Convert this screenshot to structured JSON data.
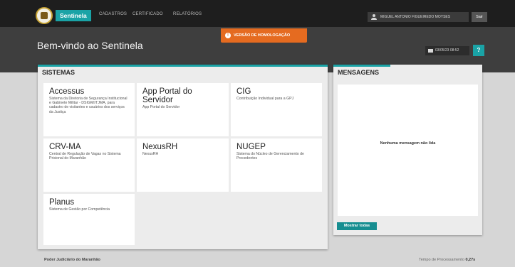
{
  "topbar": {
    "brand": "Sentinela",
    "nav": [
      "CADASTROS",
      "CERTIFICADO",
      "RELATÓRIOS"
    ],
    "user": "MIGUEL ANTONIO FIGUEIREDO MOYSES",
    "exit_label": "Sair"
  },
  "banner": {
    "homolog": "VERSÃO DE HOMOLOGAÇÃO"
  },
  "header": {
    "welcome": "Bem-vindo ao Sentinela",
    "datetime": "03/05/23 08:52",
    "help_label": "?"
  },
  "sistemas": {
    "title": "SISTEMAS",
    "cards": [
      {
        "title": "Accessus",
        "desc": "Sistema da Diretoria de Segurança Institucional e Gabinete Militar - DSIGMI/TJMA, para cadastro de visitantes e usuários dos serviços da Justiça"
      },
      {
        "title": "App Portal do Servidor",
        "desc": "App Portal do Servidor"
      },
      {
        "title": "CIG",
        "desc": "Contribuição Individual para a GPJ"
      },
      {
        "title": "CRV-MA",
        "desc": "Central de Regulação de Vagas no Sistema Prisional do Maranhão"
      },
      {
        "title": "NexusRH",
        "desc": "NexusRH"
      },
      {
        "title": "NUGEP",
        "desc": "Sistema do Núcleo de Gerenciamento de Precedentes"
      },
      {
        "title": "Planus",
        "desc": "Sistema de Gestão por Competência"
      }
    ]
  },
  "mensagens": {
    "title": "MENSAGENS",
    "empty": "Nenhuma mensagem não lida",
    "show_all": "Mostrar todas"
  },
  "footer": {
    "left": "Poder Judiciário do Maranhão",
    "time_label": "Tempo de Processamento",
    "time_value": "0,27s"
  },
  "colors": {
    "accent": "#1aa3a6",
    "warning": "#e56b20",
    "topbar": "#1e1e1e"
  }
}
